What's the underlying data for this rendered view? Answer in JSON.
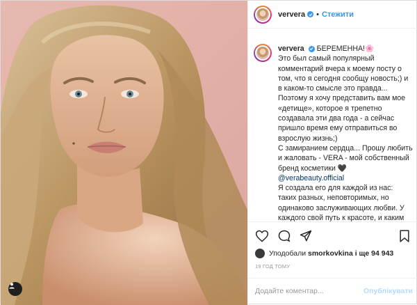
{
  "post": {
    "username": "ververa",
    "follow_label": "Стежити",
    "separator": "•",
    "caption": {
      "username": "ververa",
      "first_line": "БЕРЕМЕННА!🌸",
      "paragraph_1": "Это был самый популярный комментарий вчера к моему посту о том, что я сегодня сообщу новость;) и в каком-то смысле это правда... Поэтому я хочу представить вам мое «детище», которое я трепетно создавала эти два года - а сейчас пришло время ему отправиться во взрослую жизнь;)",
      "paragraph_2": "С замиранием сердца... Прошу любить и жаловать - VERA - мой собственный бренд косметики 🖤",
      "mention": "@verabeauty.official",
      "paragraph_3": "Я создала его для каждой из нас: таких разных, неповторимых, но одинаково заслуживающих любви. У каждого свой путь к красоте, и каким бы он сложным ни был ,"
    },
    "likes": {
      "prefix": "Уподобали",
      "liker": "smorkovkina",
      "suffix": "і ще 94 943"
    },
    "timestamp": "19 ГОД ТОМУ",
    "comment_placeholder": "Додайте коментар...",
    "publish_label": "Опублікувати"
  },
  "icons": [
    "heart-icon",
    "comment-icon",
    "share-icon",
    "bookmark-icon",
    "verified-icon",
    "user-tag-icon"
  ],
  "colors": {
    "accent": "#3897f0",
    "publish_disabled": "#b3dbff",
    "muted": "#999999",
    "photo_background": "#e3b1a8"
  }
}
